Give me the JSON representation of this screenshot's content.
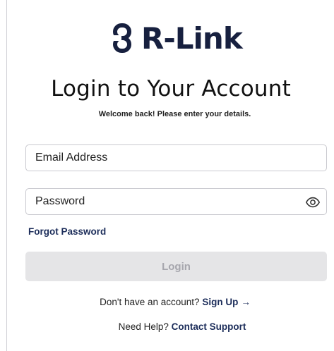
{
  "brand": {
    "name": "R-Link",
    "icon": "chain-link-logo-icon",
    "color": "#17203f"
  },
  "heading": {
    "title": "Login to Your Account",
    "subtitle": "Welcome back! Please enter your details."
  },
  "form": {
    "email_placeholder": "Email Address",
    "password_placeholder": "Password",
    "password_toggle_icon": "eye-icon",
    "forgot_label": "Forgot Password",
    "login_label": "Login"
  },
  "footer": {
    "signup_prompt": "Don't have an account?",
    "signup_link": "Sign Up",
    "signup_arrow": "→",
    "help_prompt": "Need Help?",
    "help_link": "Contact Support"
  },
  "colors": {
    "accent": "#1c2d5a",
    "button_disabled_bg": "#e5e5e7",
    "button_disabled_text": "#a6a6ad"
  }
}
